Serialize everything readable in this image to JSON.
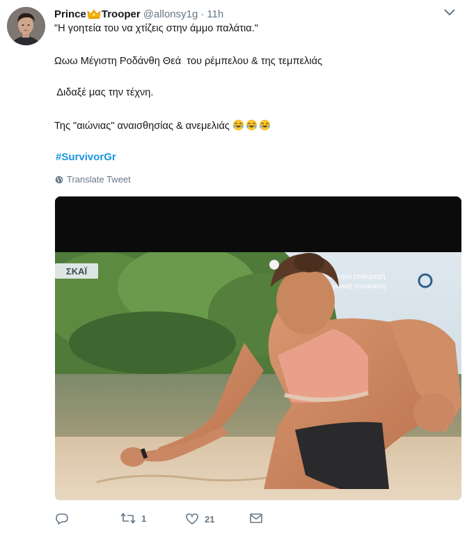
{
  "tweet": {
    "author": {
      "name_part1": "Prince",
      "name_part2": "Trooper",
      "handle": "@allonsy1g",
      "separator": "·",
      "time": "11h"
    },
    "lines": [
      "\"Η γοητεία του να χτίζεις στην άμμο παλάτια.\"",
      "Ωωω Μέγιστη Ροδάνθη Θεά  του ρέμπελου & της τεμπελιάς",
      " Διδαξέ μας την τέχνη.",
      "Της \"αιώνιας\" αναισθησίας & ανεμελιάς"
    ],
    "emoji": [
      "face-with-tears-of-joy",
      "face-with-tears-of-joy",
      "face-with-tears-of-joy"
    ],
    "hashtag": "#SurvivorGr",
    "translate_label": "Translate Tweet",
    "media": {
      "channel_logo": "ΣΚΑΪ",
      "overlay_line1": "κατάλληλο επιθυμητή",
      "overlay_line2": "η γονική συναίνεση"
    },
    "actions": {
      "reply_count": "",
      "retweet_count": "1",
      "like_count": "21"
    }
  },
  "colors": {
    "link": "#1b95e0",
    "meta": "#657786",
    "text": "#14171a"
  }
}
